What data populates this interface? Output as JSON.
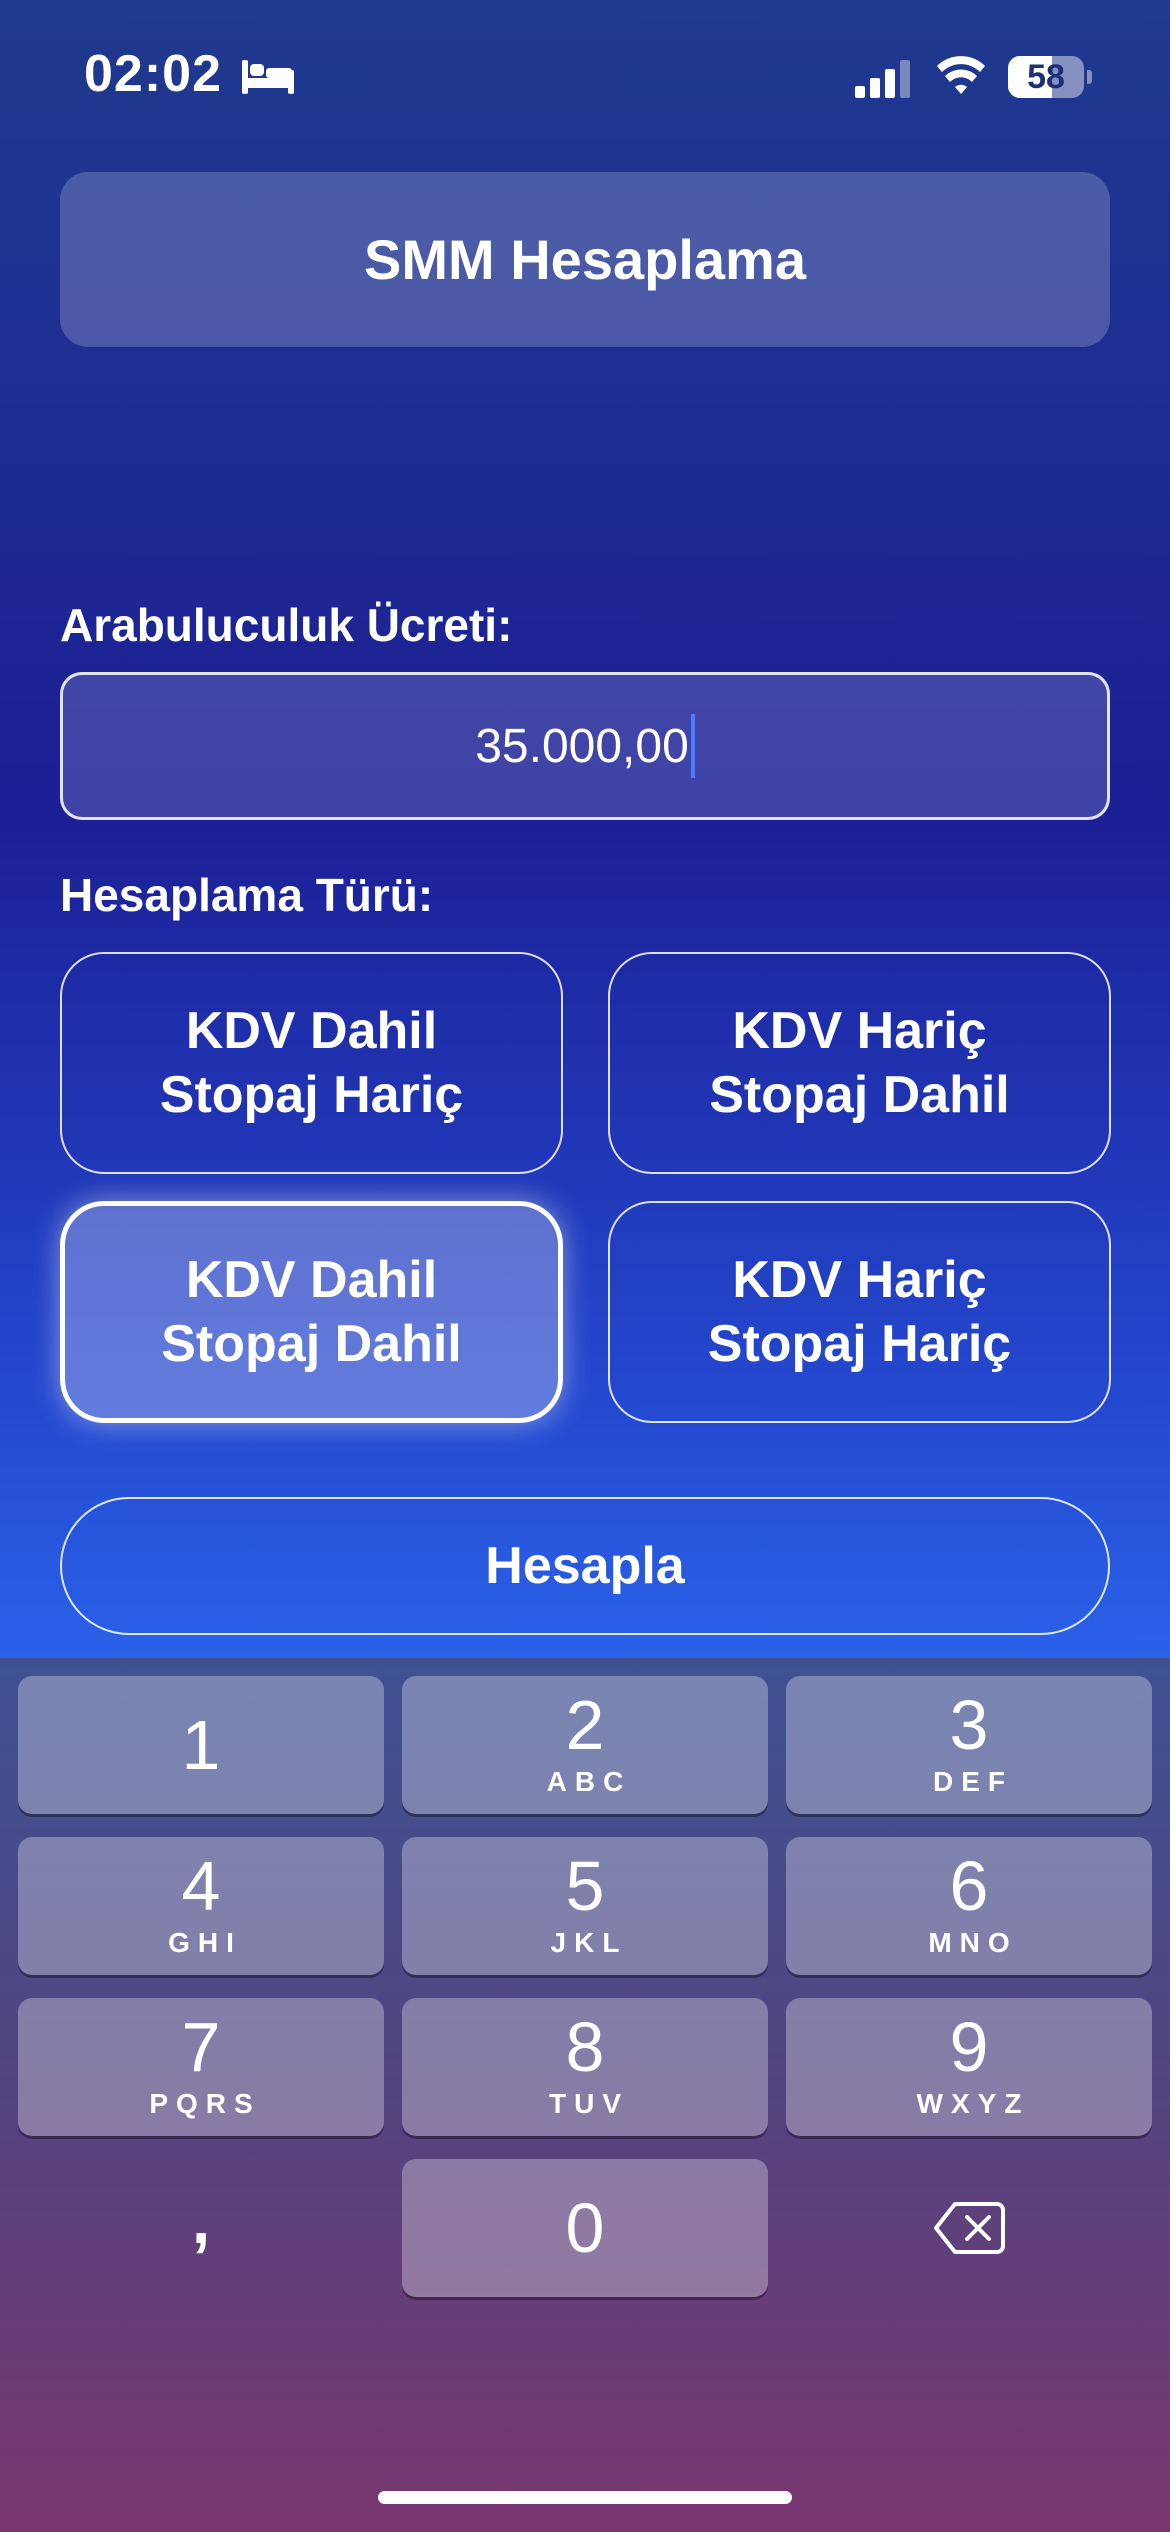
{
  "status_bar": {
    "time": "02:02",
    "battery_level": "58",
    "battery_fraction": 0.58
  },
  "header": {
    "title": "SMM Hesaplama"
  },
  "form": {
    "amount_label": "Arabuluculuk Ücreti:",
    "amount_value": "35.000,00",
    "type_label": "Hesaplama Türü:",
    "type_options": [
      {
        "line1": "KDV Dahil",
        "line2": "Stopaj Hariç",
        "selected": false
      },
      {
        "line1": "KDV Hariç",
        "line2": "Stopaj Dahil",
        "selected": false
      },
      {
        "line1": "KDV Dahil",
        "line2": "Stopaj Dahil",
        "selected": true
      },
      {
        "line1": "KDV Hariç",
        "line2": "Stopaj Hariç",
        "selected": false
      }
    ],
    "calculate_label": "Hesapla"
  },
  "keypad": {
    "keys": [
      {
        "digit": "1",
        "letters": ""
      },
      {
        "digit": "2",
        "letters": "ABC"
      },
      {
        "digit": "3",
        "letters": "DEF"
      },
      {
        "digit": "4",
        "letters": "GHI"
      },
      {
        "digit": "5",
        "letters": "JKL"
      },
      {
        "digit": "6",
        "letters": "MNO"
      },
      {
        "digit": "7",
        "letters": "PQRS"
      },
      {
        "digit": "8",
        "letters": "TUV"
      },
      {
        "digit": "9",
        "letters": "WXYZ"
      },
      {
        "digit": "0",
        "letters": ""
      }
    ],
    "separator": ","
  },
  "icons": {
    "sleep": "bed-icon",
    "signal": "cellular-signal-icon",
    "wifi": "wifi-icon",
    "backspace": "backspace-icon"
  },
  "colors": {
    "accent_caret": "#4b7bff",
    "background_top": "#1f3a8e",
    "background_bottom": "#2a63ea"
  }
}
